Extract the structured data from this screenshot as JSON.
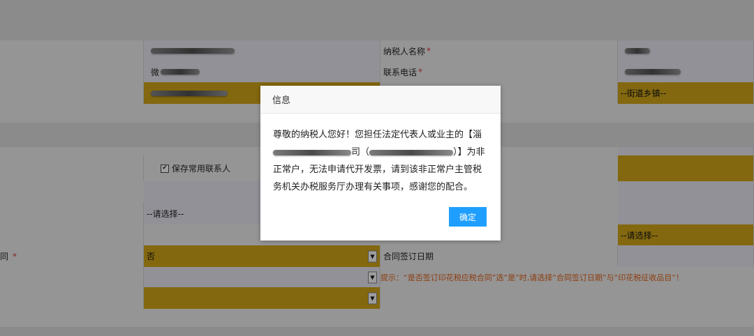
{
  "form": {
    "taxpayer_name_label": "纳税人名称",
    "phone_label": "联系电话",
    "required_mark": "*",
    "street_placeholder": "--街道乡镇--",
    "save_contact_label": "保存常用联系人",
    "please_select": "--请选择--",
    "contract_label_partial": "同",
    "contract_value": "否",
    "contract_date_label": "合同签订日期",
    "agency_partial": "微",
    "hint_text": "提示：“是否签订印花税应税合同”选“是”时,请选择“合同签订日期”与“印花税征收品目”！",
    "dropdown_arrow": "▼",
    "checkbox_mark": "✔"
  },
  "dialog": {
    "title": "信息",
    "message_part1": "尊敬的纳税人您好！您担任法定代表人或业主的【淄",
    "message_part2": "司（",
    "message_part3": "）】为非",
    "message_part4": "正常户，无法申请代开发票，请到该非正常户主管税务机关办税服务厅办理有关事项，感谢您的配合。",
    "confirm_label": "确定"
  },
  "colors": {
    "yellow_field": "#c19a17",
    "confirm_button": "#1e9fff",
    "hint": "#d05a18",
    "required": "#cc3333"
  }
}
